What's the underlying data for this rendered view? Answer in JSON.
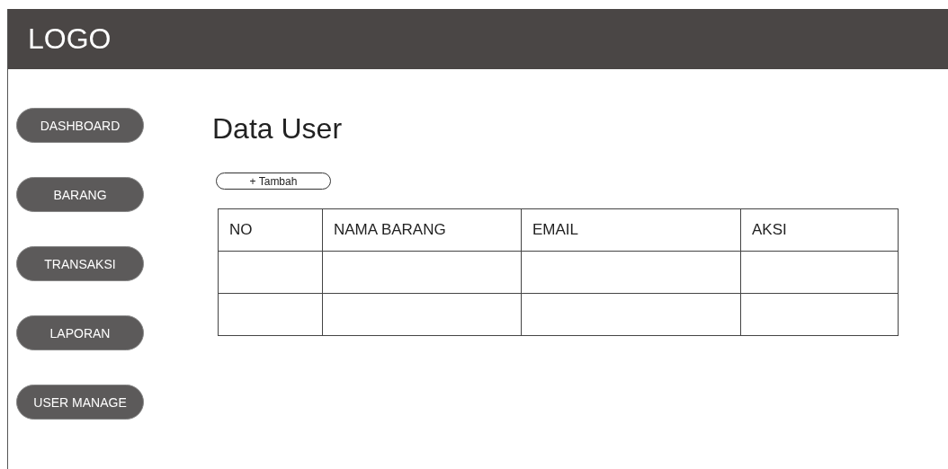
{
  "header": {
    "logo": "LOGO"
  },
  "sidebar": {
    "items": [
      {
        "label": "DASHBOARD"
      },
      {
        "label": "BARANG"
      },
      {
        "label": "TRANSAKSI"
      },
      {
        "label": "LAPORAN"
      },
      {
        "label": "USER MANAGE"
      }
    ]
  },
  "page": {
    "title": "Data User",
    "add_button": "+ Tambah"
  },
  "table": {
    "columns": [
      "NO",
      "NAMA BARANG",
      "EMAIL",
      "AKSI"
    ],
    "rows": [
      {
        "kind": "blank"
      },
      {
        "kind": "blank"
      }
    ]
  }
}
